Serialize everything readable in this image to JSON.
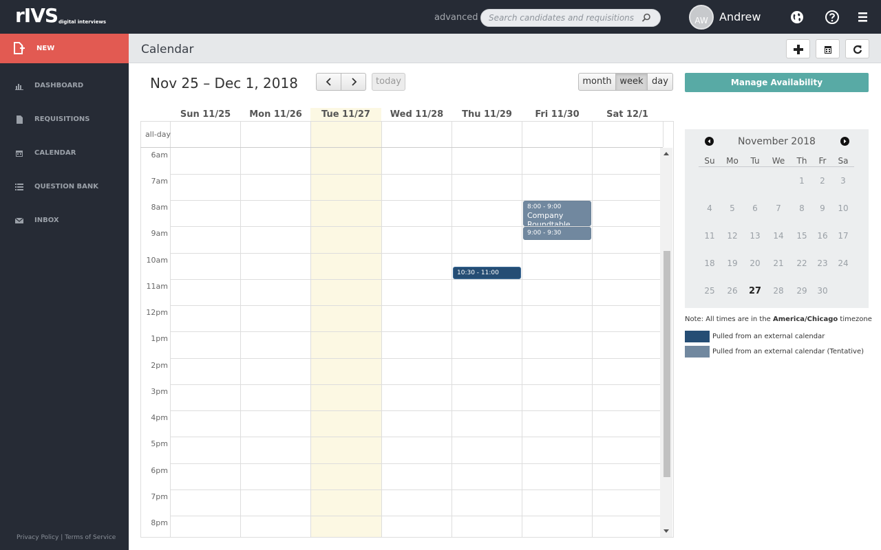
{
  "app": {
    "logo_word": "rIVS",
    "logo_tagline": "digital interviews",
    "advanced_link": "advanced",
    "search_placeholder": "Search candidates and requisitions",
    "user_initials": "AW",
    "user_name": "Andrew",
    "icons": [
      "globe-icon",
      "help-icon",
      "hamburger-menu-icon",
      "search-icon"
    ]
  },
  "sidebar": {
    "new_label": "NEW",
    "items": [
      {
        "label": "DASHBOARD",
        "icon": "bar-chart-icon"
      },
      {
        "label": "REQUISITIONS",
        "icon": "document-icon"
      },
      {
        "label": "CALENDAR",
        "icon": "calendar-icon"
      },
      {
        "label": "QUESTION BANK",
        "icon": "list-icon"
      },
      {
        "label": "INBOX",
        "icon": "envelope-icon"
      }
    ],
    "footer": {
      "privacy": "Privacy Policy",
      "separator": "|",
      "terms": "Terms of Service"
    }
  },
  "header": {
    "title": "Calendar",
    "buttons": [
      "add-icon",
      "calendar-icon",
      "refresh-icon"
    ]
  },
  "calendar": {
    "range_title": "Nov 25 – Dec 1, 2018",
    "today_button": "today",
    "view_buttons": {
      "month": "month",
      "week": "week",
      "day": "day"
    },
    "active_view": "week",
    "days": [
      "Sun 11/25",
      "Mon 11/26",
      "Tue 11/27",
      "Wed 11/28",
      "Thu 11/29",
      "Fri 11/30",
      "Sat 12/1"
    ],
    "today_index": 2,
    "allday_label": "all-day",
    "time_labels": [
      "6am",
      "7am",
      "8am",
      "9am",
      "10am",
      "11am",
      "12pm",
      "1pm",
      "2pm",
      "3pm",
      "4pm",
      "5pm",
      "6pm",
      "7pm",
      "8pm"
    ],
    "events": [
      {
        "day": "Fri 11/30",
        "time": "8:00 - 9:00",
        "title": "Company Roundtable",
        "type": "tentative"
      },
      {
        "day": "Fri 11/30",
        "time": "9:00 - 9:30",
        "title": "",
        "type": "tentative"
      },
      {
        "day": "Thu 11/29",
        "time": "10:30 - 11:00",
        "title": "",
        "type": "external"
      }
    ]
  },
  "right_panel": {
    "manage_button": "Manage Availability",
    "mini_calendar": {
      "title": "November 2018",
      "dow": [
        "Su",
        "Mo",
        "Tu",
        "We",
        "Th",
        "Fr",
        "Sa"
      ],
      "weeks": [
        [
          "",
          "",
          "",
          "",
          "1",
          "2",
          "3"
        ],
        [
          "4",
          "5",
          "6",
          "7",
          "8",
          "9",
          "10"
        ],
        [
          "11",
          "12",
          "13",
          "14",
          "15",
          "16",
          "17"
        ],
        [
          "18",
          "19",
          "20",
          "21",
          "22",
          "23",
          "24"
        ],
        [
          "25",
          "26",
          "27",
          "28",
          "29",
          "30",
          ""
        ]
      ],
      "today": "27"
    },
    "tz_note": {
      "prefix": "Note: All times are in the ",
      "zone": "America/Chicago",
      "suffix": " timezone"
    },
    "legend": [
      {
        "label": "Pulled from an external calendar",
        "color": "#254d74"
      },
      {
        "label": "Pulled from an external calendar (Tentative)",
        "color": "#71889f"
      }
    ]
  },
  "colors": {
    "topbar": "#262b35",
    "new_button": "#e25a52",
    "manage_button": "#58aaa5",
    "today_highlight": "#fcf8e3",
    "event_external": "#254d74",
    "event_tentative": "#71889f"
  }
}
